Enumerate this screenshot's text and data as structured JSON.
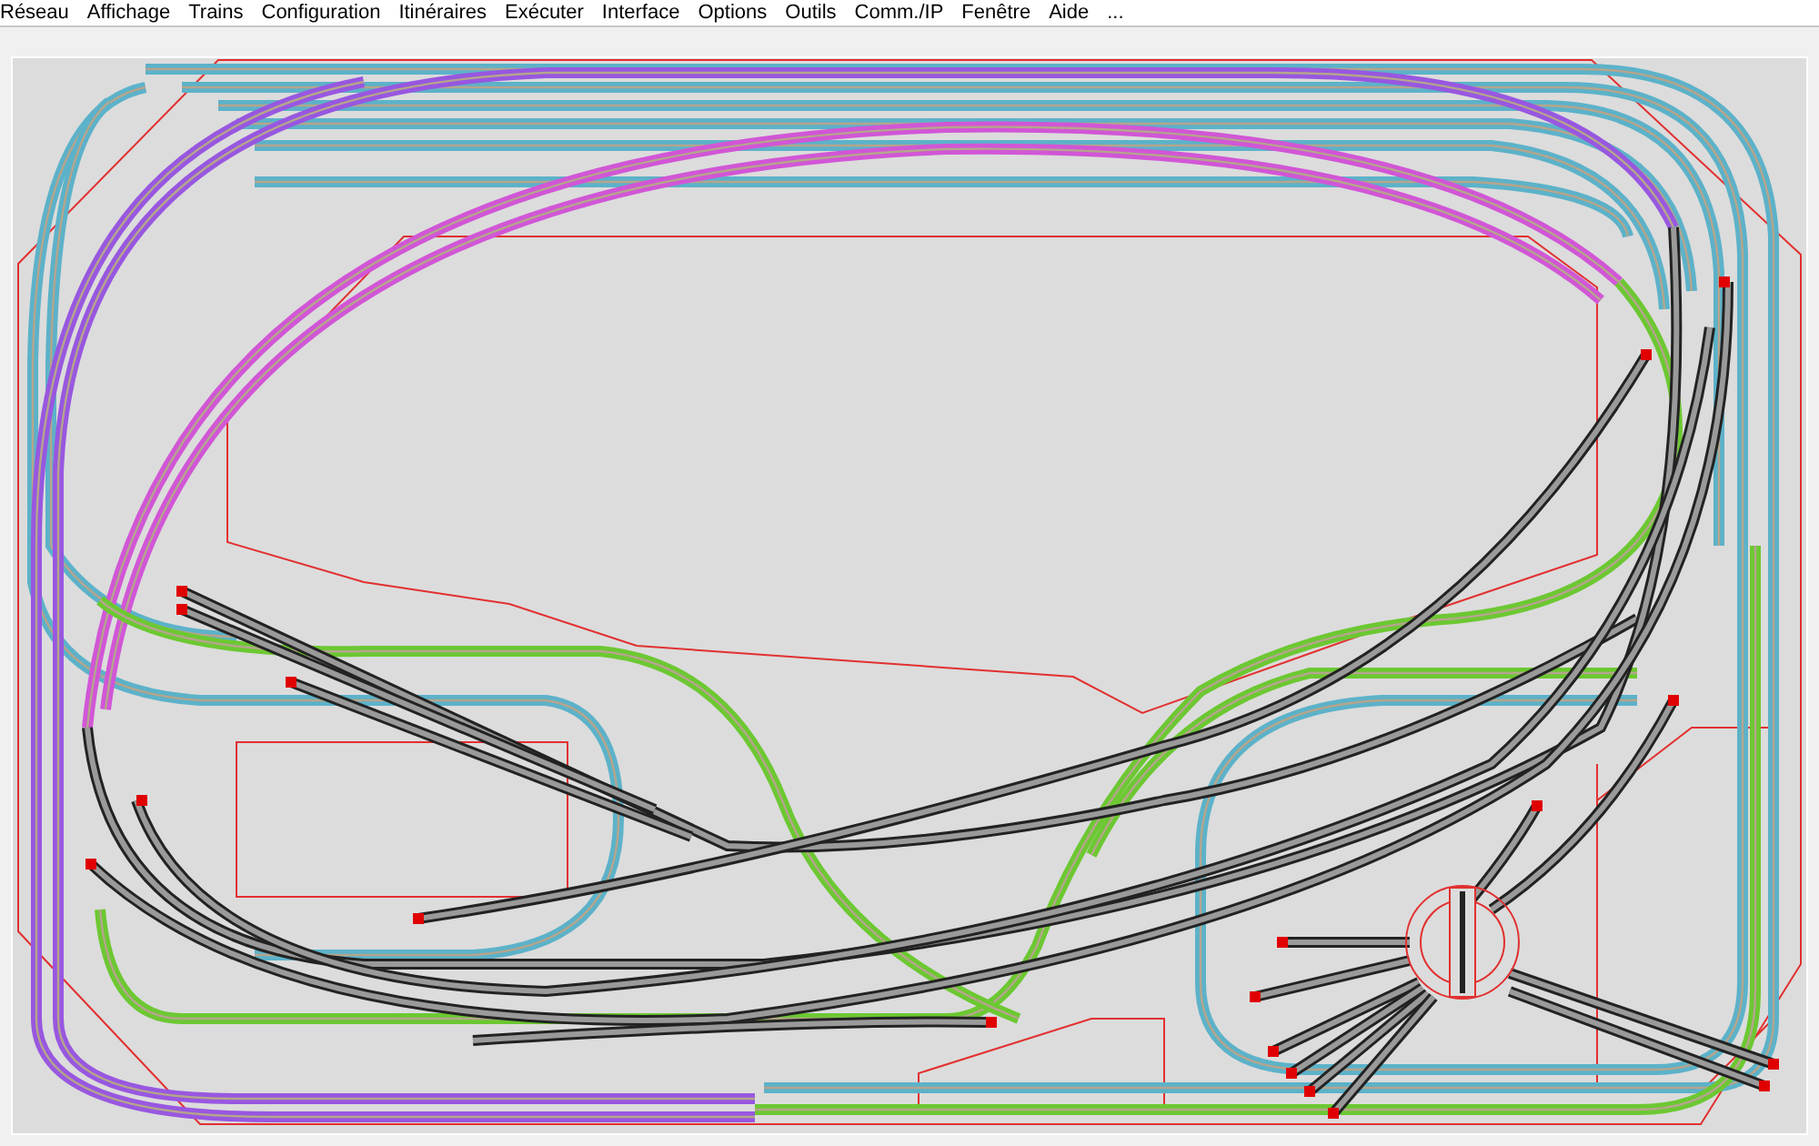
{
  "menu": [
    {
      "label": "Réseau"
    },
    {
      "label": "Affichage"
    },
    {
      "label": "Trains"
    },
    {
      "label": "Configuration"
    },
    {
      "label": "Itinéraires"
    },
    {
      "label": "Exécuter"
    },
    {
      "label": "Interface"
    },
    {
      "label": "Options"
    },
    {
      "label": "Outils"
    },
    {
      "label": "Comm./IP"
    },
    {
      "label": "Fenêtre"
    },
    {
      "label": "Aide"
    },
    {
      "label": "..."
    }
  ]
}
